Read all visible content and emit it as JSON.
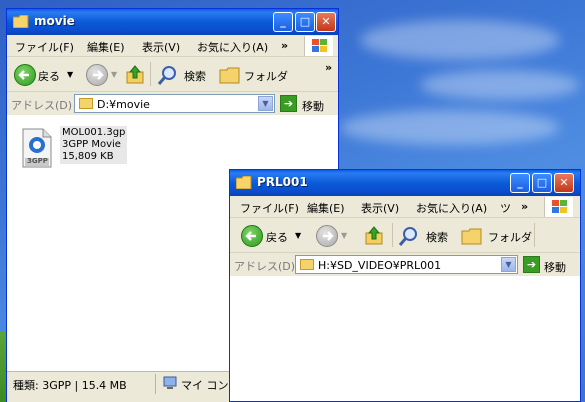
{
  "window1": {
    "title": "movie",
    "menu": [
      "ファイル(F)",
      "編集(E)",
      "表示(V)",
      "お気に入り(A)"
    ],
    "menu_more": "»",
    "toolbar": {
      "back": "戻る",
      "search": "検索",
      "folders": "フォルダ",
      "more": "»"
    },
    "address_label": "アドレス(D)",
    "address": "D:¥movie",
    "go": "移動",
    "file": {
      "name": "MOL001.3gp",
      "type": "3GPP Movie",
      "size": "15,809 KB",
      "icon_label": "3GPP"
    },
    "status_left": "種類: 3GPP | 15.4 MB",
    "status_right": "マイ コンピ"
  },
  "window2": {
    "title": "PRL001",
    "menu": [
      "ファイル(F)",
      "編集(E)",
      "表示(V)",
      "お気に入り(A)",
      "ツ"
    ],
    "menu_more": "»",
    "toolbar": {
      "back": "戻る",
      "search": "検索",
      "folders": "フォルダ"
    },
    "address_label": "アドレス(D)",
    "address": "H:¥SD_VIDEO¥PRL001",
    "go": "移動"
  },
  "colors": {
    "title_blue": "#0a5ee6",
    "close_red": "#c2371a",
    "go_green": "#3a9d23",
    "folder_yellow": "#f5d36b"
  }
}
